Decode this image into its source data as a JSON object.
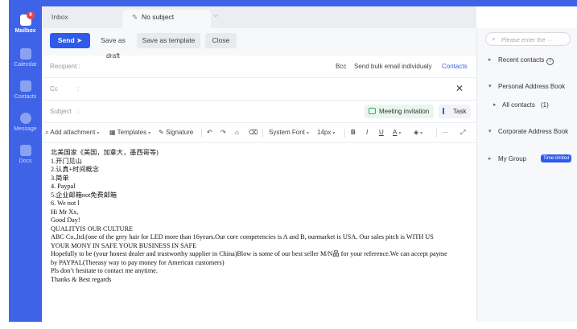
{
  "rail": {
    "mailbox": "Mailbox",
    "badge": "9",
    "calendar": "Calendar",
    "contacts": "Contacts",
    "message": "Message",
    "docs": "Docs"
  },
  "tabs": {
    "inbox": "Inbox",
    "draft": "No subject"
  },
  "toolbar": {
    "send": "Send",
    "save_draft": "Save as draft",
    "save_template": "Save as template",
    "close": "Close"
  },
  "fields": {
    "recipient_label": "Recipient :",
    "bcc": "Bcc",
    "bulk": "Send bulk email individualy",
    "contacts": "Contacts",
    "cc_label": "Cc",
    "cc_colon": ":",
    "subject_label": "Subject",
    "subject_colon": ":",
    "meeting": "Meeting invitation",
    "task": "Task"
  },
  "format": {
    "attachment": "Add attachment",
    "templates": "Templates",
    "signature": "Signature",
    "font": "System Font",
    "size": "14px",
    "bold": "B",
    "italic": "I",
    "underline": "U",
    "color": "A",
    "more": "···"
  },
  "body_lines": [
    "北美国家《美国，加拿大，墨西哥等)",
    "1.开门见山",
    "2.认真+时间概念",
    "3.简单",
    "4. Paypal",
    "5.企业邮箱not免费邮箱",
    "6. We not l",
    "Hi Mr Xx,",
    "Good Day!",
    "QUALITYIS OUR CULTURE",
    "ABC Co.,ltd.(one of the grey hair for LED more than 16years.Our core competencies is A and B, ourmarket is USA. Our sales pitch is WITH US",
    "YOUR MONY IN SAFE YOUR BUSINESS IN SAFE",
    "Hopefully to be (your honest dealer and trustworthy supplier in China)Blow is some of our best seller M/N品 for your reference.We can accept payme",
    "by PAYPAL(Theeasy way to pay money for American customers)",
    "Pls don’t hesitate to contact me anytime.",
    "Thanks & Best regards"
  ],
  "right_panel": {
    "search_placeholder": "Please enter the ···",
    "recent": "Recent contacts",
    "personal": "Personal Address Book",
    "all_contacts": "All contacts",
    "all_count": "(1)",
    "corporate": "Corporate Address Book",
    "my_group": "My Group",
    "time_limited": "Time-limited"
  },
  "colors": {
    "accent": "#3e63e6",
    "primary_button": "#2e5bea"
  }
}
